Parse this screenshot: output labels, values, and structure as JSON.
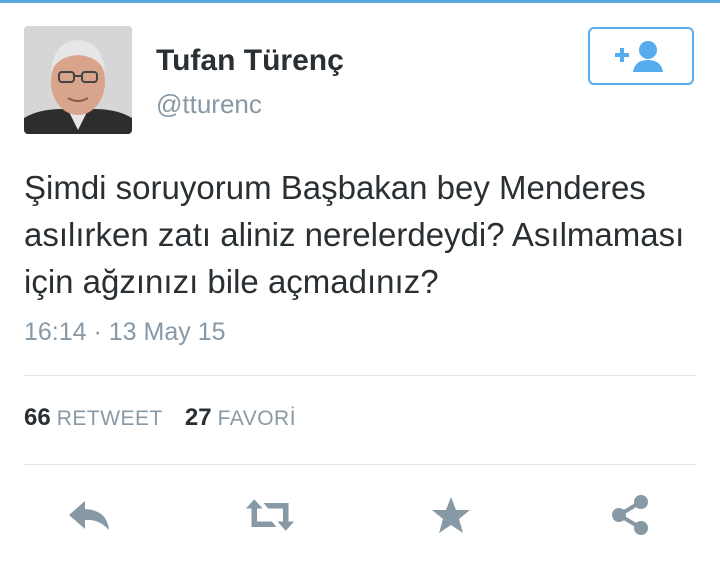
{
  "user": {
    "name": "Tufan Türenç",
    "handle": "@tturenc"
  },
  "follow_button": {
    "icon": "add-user-icon"
  },
  "tweet": {
    "text": "Şimdi soruyorum Başbakan bey Menderes asılırken zatı aliniz nerelerdeydi? Asılmaması için ağzınızı bile açmadınız?",
    "timestamp": "16:14 · 13 May 15"
  },
  "stats": {
    "retweet_count": "66",
    "retweet_label": "RETWEET",
    "favorite_count": "27",
    "favorite_label": "FAVORİ"
  },
  "actions": [
    {
      "icon": "reply-icon"
    },
    {
      "icon": "retweet-icon"
    },
    {
      "icon": "star-icon"
    },
    {
      "icon": "share-icon"
    }
  ],
  "colors": {
    "accent": "#55acee",
    "text": "#292f33",
    "muted": "#8899a6",
    "action_icon": "#8899a6",
    "divider": "#e1e8ed"
  }
}
